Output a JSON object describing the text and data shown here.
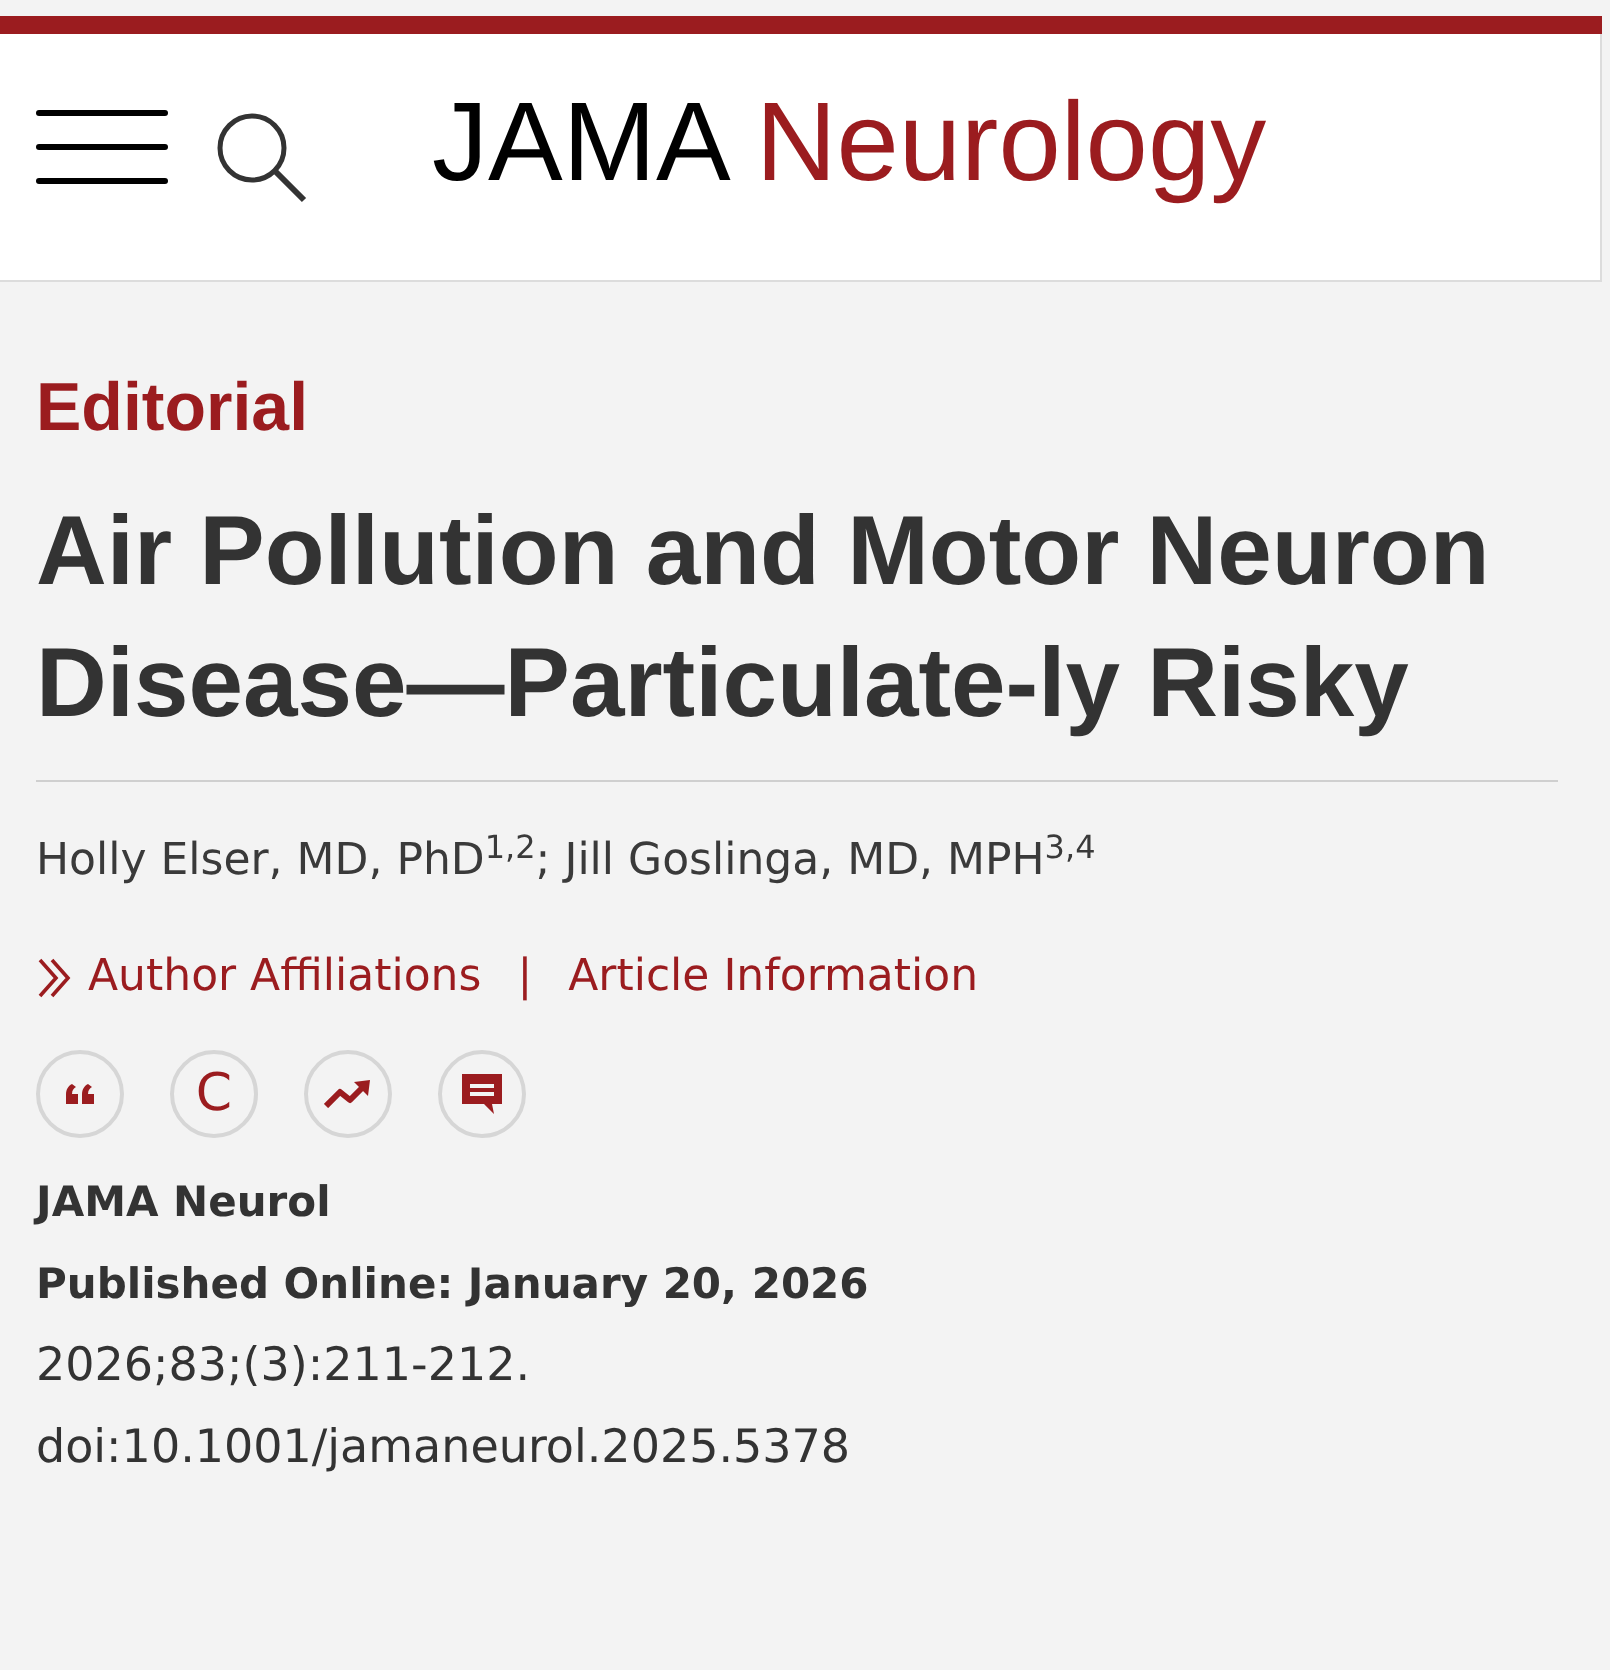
{
  "header": {
    "logo": {
      "brand": "JAMA",
      "journal": "Neurology"
    }
  },
  "article": {
    "type": "Editorial",
    "title": "Air Pollution and Motor Neuron Disease—Particulate-ly Risky",
    "authors": "Holly Elser, MD, PhD$^{1,2}$; Jill Goslinga, MD, MPH$^{3,4}$",
    "links": {
      "separator": "|",
      "items": [
        {
          "label": "Author Affiliations",
          "kind": "toggle"
        },
        {
          "label": "Article Information",
          "kind": "plain"
        }
      ]
    },
    "actions": [
      {
        "kind": "quote"
      },
      {
        "kind": "letter",
        "label": "C"
      },
      {
        "kind": "trend"
      },
      {
        "kind": "comment"
      }
    ],
    "journal": "JAMA Neurol",
    "published": "Published Online: January 20, 2026",
    "citation": "2026;83;(3):211-212.",
    "doi": "doi:10.1001/jamaneurol.2025.5378"
  }
}
